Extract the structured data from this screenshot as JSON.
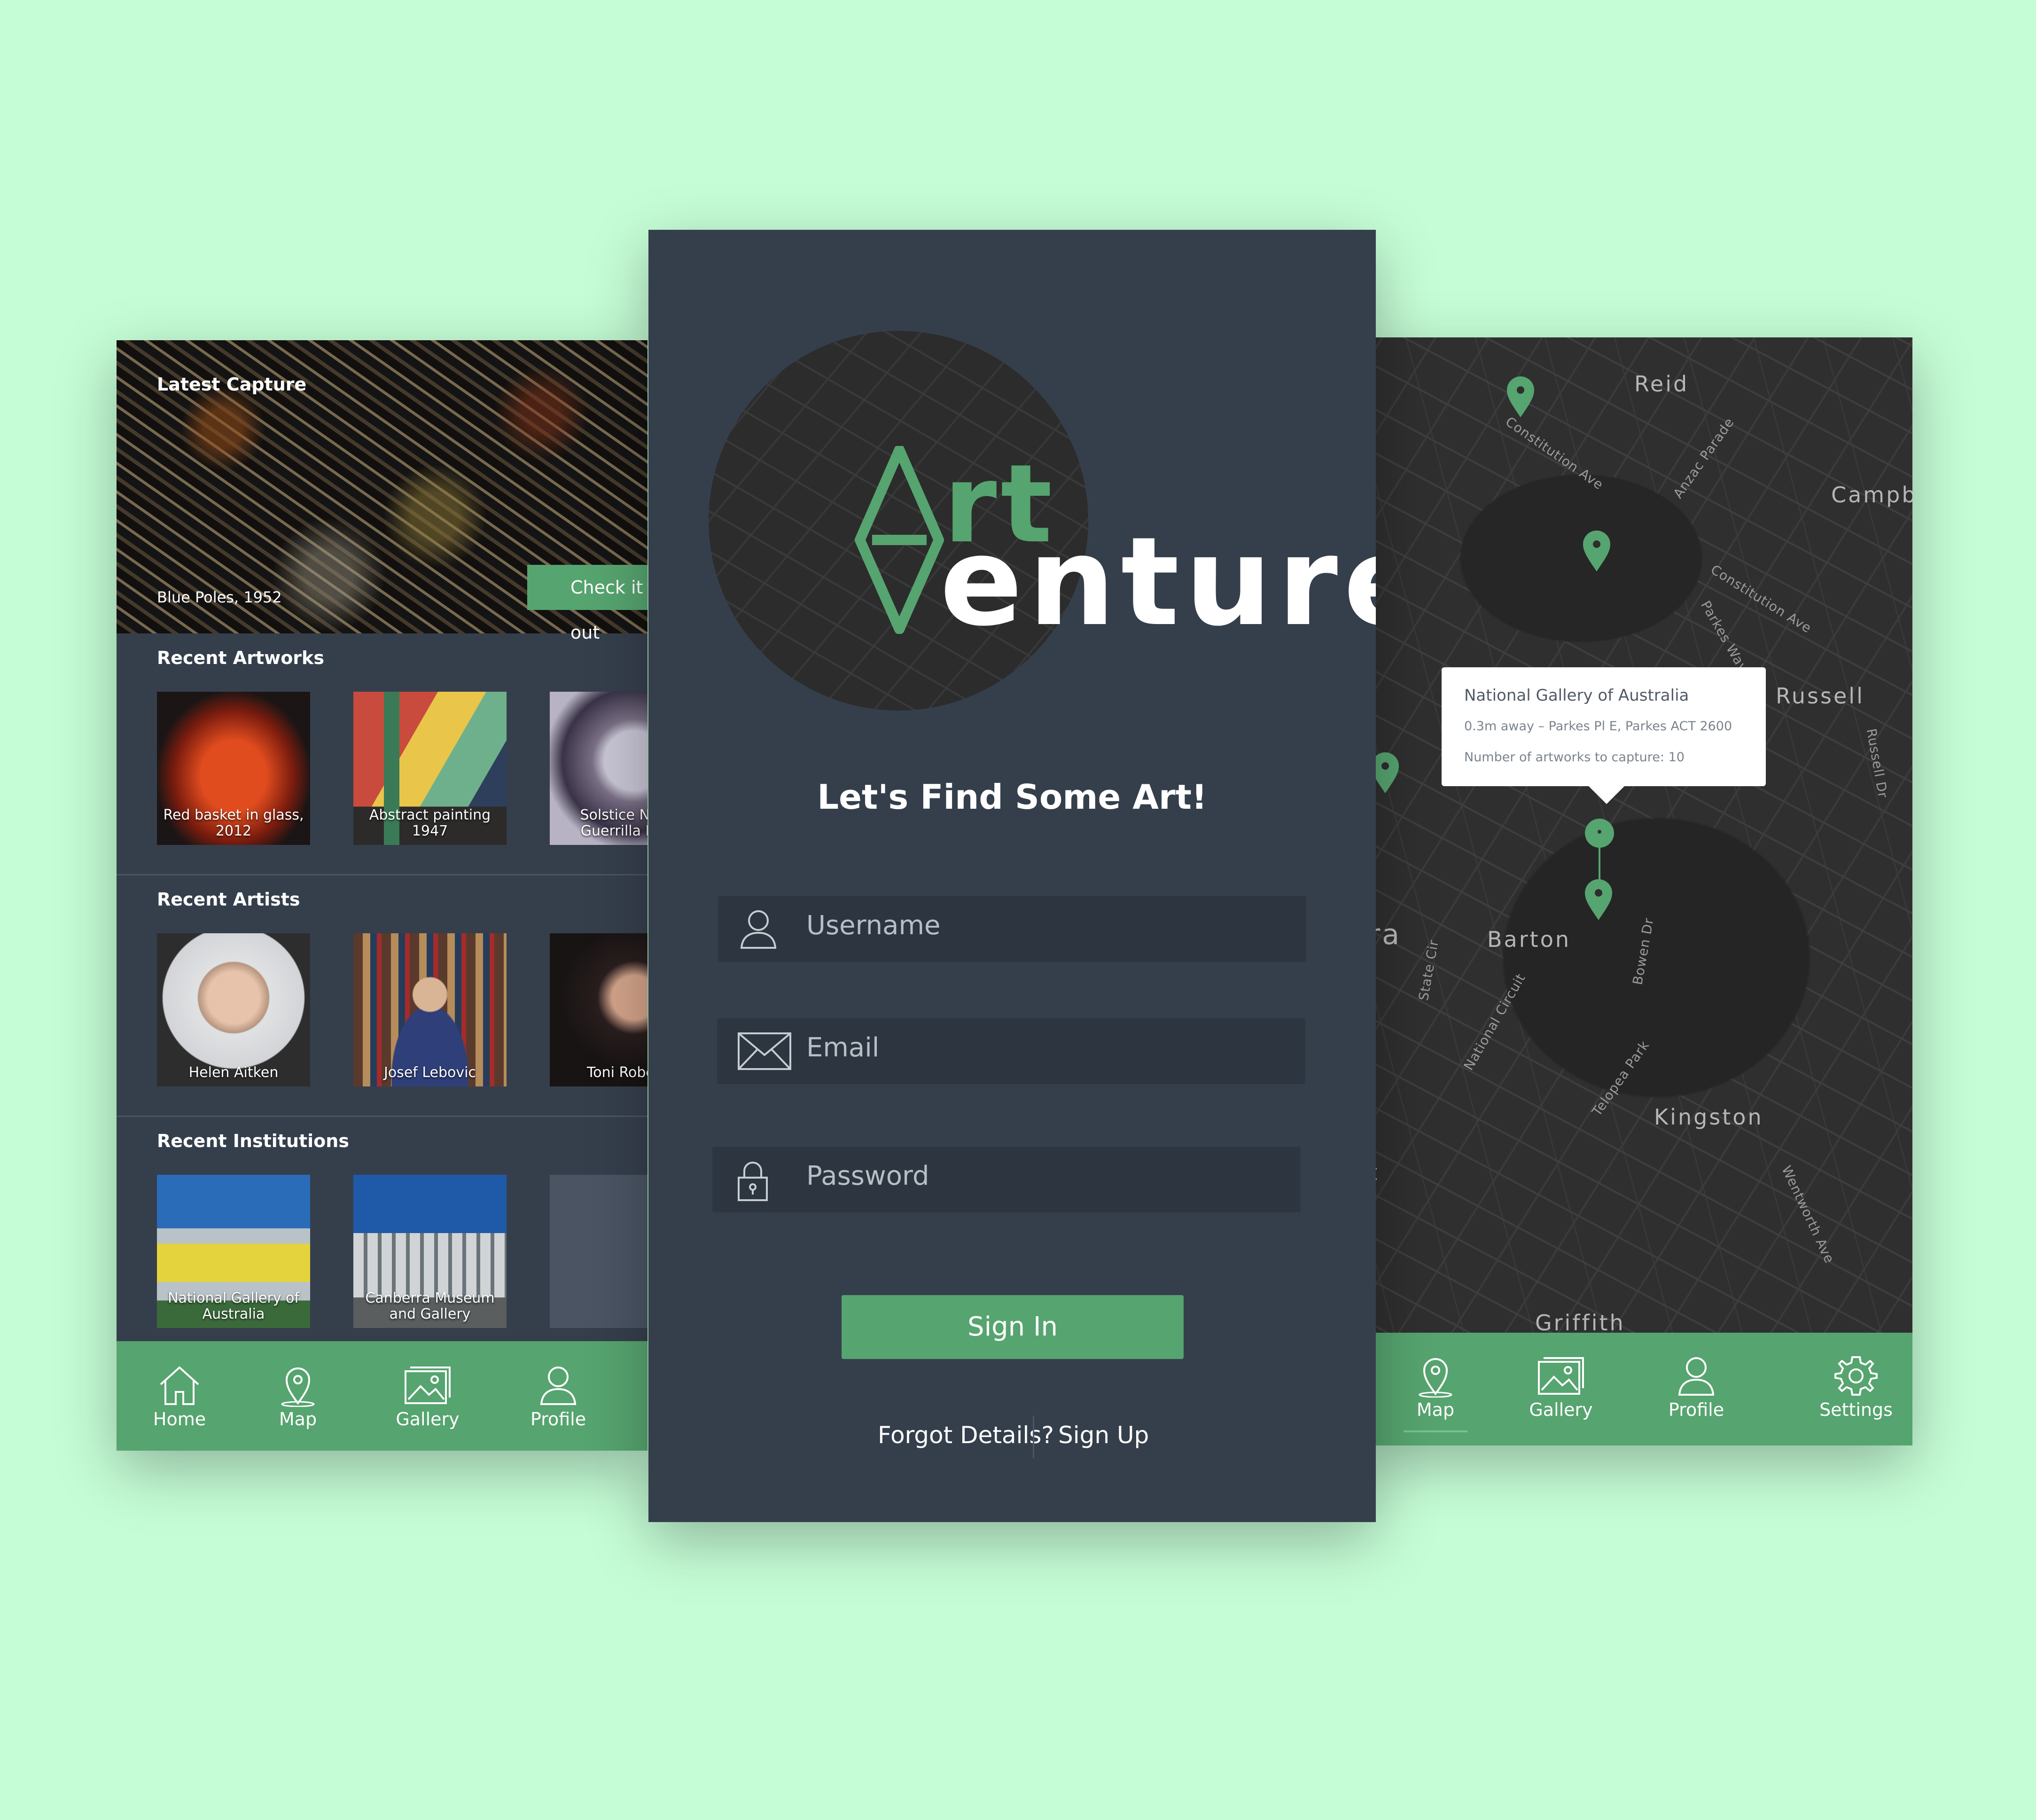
{
  "colors": {
    "background": "#c5fdd6",
    "panel": "#353f4c",
    "accent": "#56a46f",
    "field": "#2d3541"
  },
  "left_screen": {
    "hero": {
      "title": "Latest Capture",
      "caption": "Blue Poles, 1952",
      "button": "Check it out"
    },
    "sections": {
      "artworks": {
        "title": "Recent Artworks",
        "items": [
          {
            "label": "Red basket in glass, 2012"
          },
          {
            "label": "Abstract painting 1947"
          },
          {
            "label": "Solstice Note Guerrilla Boy"
          }
        ]
      },
      "artists": {
        "title": "Recent Artists",
        "items": [
          {
            "label": "Helen Aitken"
          },
          {
            "label": "Josef Lebovic"
          },
          {
            "label": "Toni Robert"
          }
        ]
      },
      "institutions": {
        "title": "Recent Institutions",
        "items": [
          {
            "label": "National Gallery of Australia"
          },
          {
            "label": "Canberra Museum and Gallery"
          }
        ]
      }
    },
    "nav": [
      {
        "label": "Home",
        "icon": "home-icon"
      },
      {
        "label": "Map",
        "icon": "map-pin-icon"
      },
      {
        "label": "Gallery",
        "icon": "gallery-icon"
      },
      {
        "label": "Profile",
        "icon": "profile-icon"
      }
    ]
  },
  "center_screen": {
    "logo": {
      "line1": "rt",
      "line2": "enture"
    },
    "tagline": "Let's Find Some Art!",
    "fields": {
      "username": "Username",
      "email": "Email",
      "password": "Password"
    },
    "sign_in": "Sign In",
    "forgot": "Forgot Details?",
    "sign_up": "Sign Up"
  },
  "right_screen": {
    "map_labels": [
      "Reid",
      "Campb",
      "Russell",
      "Barton",
      "Kingston",
      "rra",
      "st",
      "Griffith"
    ],
    "street_labels": [
      "Constitution Ave",
      "Anzac Parade",
      "Constitution Ave",
      "Parkes Way",
      "State Cir",
      "National Circuit",
      "Telopea Park",
      "Wentworth Ave",
      "Bowen Dr",
      "Russell Dr"
    ],
    "popup": {
      "title": "National Gallery of Australia",
      "address": "0.3m away – Parkes Pl E, Parkes ACT 2600",
      "count": "Number of artworks to capture: 10"
    },
    "nav": [
      {
        "label": "Map",
        "icon": "map-pin-icon"
      },
      {
        "label": "Gallery",
        "icon": "gallery-icon"
      },
      {
        "label": "Profile",
        "icon": "profile-icon"
      },
      {
        "label": "Settings",
        "icon": "settings-icon"
      }
    ]
  }
}
